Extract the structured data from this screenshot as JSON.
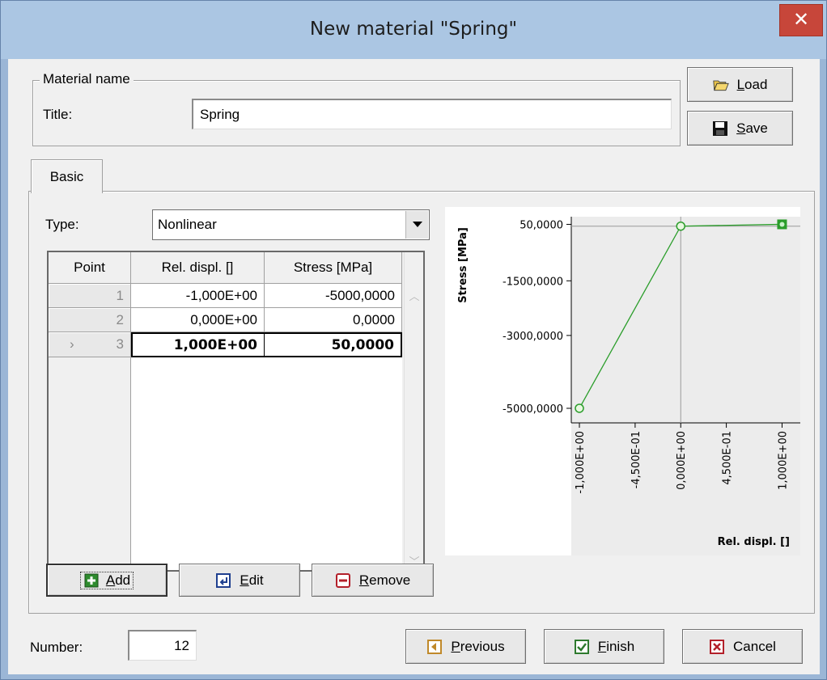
{
  "window": {
    "title": "New material \"Spring\"",
    "close_glyph": "✕"
  },
  "material_name": {
    "legend": "Material name",
    "title_label": "Title:",
    "title_value": "Spring"
  },
  "buttons": {
    "load": {
      "pre": "",
      "accel": "L",
      "post": "oad"
    },
    "save": {
      "pre": "",
      "accel": "S",
      "post": "ave"
    },
    "add": {
      "pre": "",
      "accel": "A",
      "post": "dd"
    },
    "edit": {
      "pre": "",
      "accel": "E",
      "post": "dit"
    },
    "remove": {
      "pre": "",
      "accel": "R",
      "post": "emove"
    },
    "previous": {
      "pre": "",
      "accel": "P",
      "post": "revious"
    },
    "finish": {
      "pre": "",
      "accel": "F",
      "post": "inish"
    },
    "cancel": {
      "pre": "",
      "accel": "",
      "post": "Cancel"
    }
  },
  "tabs": [
    {
      "label": "Basic",
      "active": true
    }
  ],
  "type": {
    "label": "Type:",
    "value": "Nonlinear"
  },
  "table": {
    "headers": [
      "Point",
      "Rel. displ. []",
      "Stress [MPa]"
    ],
    "rows": [
      {
        "point": "1",
        "rel_displ": "-1,000E+00",
        "stress": "-5000,0000",
        "current": false
      },
      {
        "point": "2",
        "rel_displ": "0,000E+00",
        "stress": "0,0000",
        "current": false
      },
      {
        "point": "3",
        "rel_displ": "1,000E+00",
        "stress": "50,0000",
        "current": true
      }
    ],
    "current_row_marker": "›"
  },
  "chart_data": {
    "type": "line",
    "x": [
      -1.0,
      0.0,
      1.0
    ],
    "series": [
      {
        "values": [
          -5000,
          0,
          50
        ]
      }
    ],
    "xlabel": "Rel. displ. []",
    "ylabel": "Stress [MPa]",
    "xticks": [
      "-1,000E+00",
      "-4,500E-01",
      "0,000E+00",
      "4,500E-01",
      "1,000E+00"
    ],
    "yticks": [
      "50,0000",
      "-1500,0000",
      "-3000,0000",
      "-5000,0000"
    ],
    "xlim": [
      -1.08,
      1.18
    ],
    "ylim": [
      -5400,
      260
    ],
    "series_color": "#2a9d2a"
  },
  "number": {
    "label": "Number:",
    "value": "12"
  }
}
